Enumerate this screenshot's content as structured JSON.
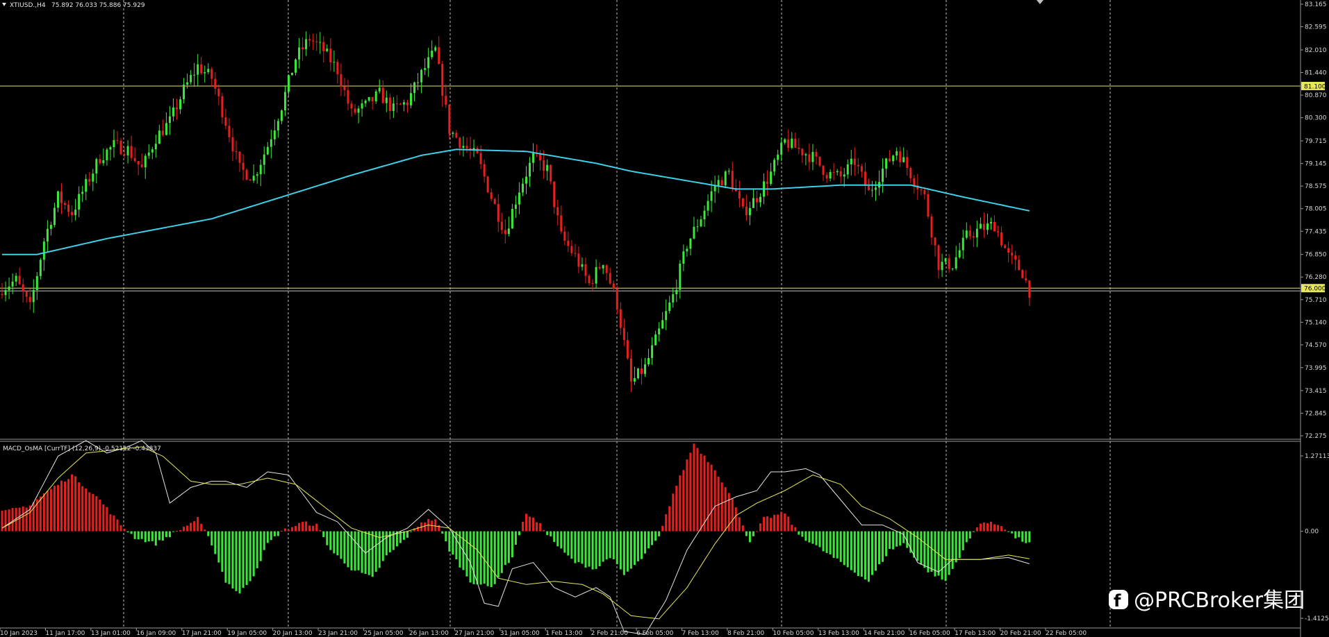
{
  "header": {
    "symbol_label": "XTIUSD.,H4",
    "ohlc": "75.892 76.033 75.886 75.929",
    "arrow_icon": "triangle-down-icon"
  },
  "indicator": {
    "label": "MACD_OsMA [CurrTF] (12,26,9) -0.52112 -0.43837"
  },
  "price_axis": {
    "labels": [
      "83.165",
      "82.595",
      "82.010",
      "81.440",
      "80.870",
      "80.300",
      "79.715",
      "79.145",
      "78.575",
      "78.005",
      "77.435",
      "76.850",
      "76.280",
      "75.710",
      "75.140",
      "74.570",
      "73.995",
      "73.415",
      "72.845",
      "72.275"
    ],
    "top": 83.165,
    "bottom": 72.275
  },
  "osma_axis": {
    "labels": [
      "1.27113",
      "0.00",
      "-1.41254"
    ],
    "top": 1.27113,
    "bottom": -1.41254
  },
  "levels": [
    {
      "value": 81.1,
      "label": "81.100",
      "color": "#e8e85a"
    },
    {
      "value": 76.0,
      "label": "76.000",
      "color": "#e8e85a"
    }
  ],
  "time_axis": [
    "10 Jan 2023",
    "11 Jan 17:00",
    "13 Jan 01:00",
    "16 Jan 09:00",
    "17 Jan 21:00",
    "19 Jan 05:00",
    "20 Jan 13:00",
    "23 Jan 21:00",
    "25 Jan 05:00",
    "26 Jan 13:00",
    "27 Jan 21:00",
    "31 Jan 05:00",
    "1 Feb 13:00",
    "2 Feb 21:00",
    "6 Feb 05:00",
    "7 Feb 13:00",
    "8 Feb 21:00",
    "10 Feb 05:00",
    "13 Feb 13:00",
    "14 Feb 21:00",
    "16 Feb 05:00",
    "17 Feb 13:00",
    "20 Feb 21:00",
    "22 Feb 05:00"
  ],
  "colors": {
    "bull": "#3be83b",
    "bear": "#e81f1f",
    "ma": "#3fd0ea",
    "macd_line": "#e6e6e6",
    "signal_line": "#e8e85a",
    "grid": "#bfbfbf",
    "background": "#000000"
  },
  "watermark": {
    "text": "@PRCBroker集团",
    "icon": "facebook-icon"
  },
  "chart_data": {
    "type": "candlestick",
    "close_anchors": [
      [
        0,
        76.0
      ],
      [
        4,
        76.2
      ],
      [
        8,
        75.5
      ],
      [
        12,
        77.2
      ],
      [
        16,
        78.3
      ],
      [
        20,
        77.9
      ],
      [
        24,
        78.6
      ],
      [
        28,
        79.3
      ],
      [
        32,
        79.6
      ],
      [
        36,
        79.5
      ],
      [
        40,
        79.0
      ],
      [
        44,
        79.8
      ],
      [
        48,
        80.2
      ],
      [
        52,
        81.0
      ],
      [
        56,
        81.6
      ],
      [
        60,
        81.3
      ],
      [
        64,
        80.2
      ],
      [
        68,
        79.0
      ],
      [
        72,
        78.8
      ],
      [
        76,
        79.6
      ],
      [
        80,
        80.6
      ],
      [
        84,
        81.8
      ],
      [
        88,
        82.3
      ],
      [
        92,
        82.0
      ],
      [
        96,
        81.5
      ],
      [
        100,
        80.4
      ],
      [
        104,
        80.6
      ],
      [
        108,
        80.9
      ],
      [
        112,
        80.5
      ],
      [
        116,
        80.7
      ],
      [
        120,
        81.4
      ],
      [
        124,
        82.0
      ],
      [
        128,
        80.0
      ],
      [
        132,
        79.6
      ],
      [
        136,
        79.3
      ],
      [
        140,
        78.3
      ],
      [
        144,
        77.4
      ],
      [
        148,
        78.5
      ],
      [
        152,
        79.3
      ],
      [
        156,
        79.0
      ],
      [
        160,
        77.3
      ],
      [
        164,
        76.8
      ],
      [
        168,
        76.1
      ],
      [
        172,
        76.7
      ],
      [
        176,
        75.6
      ],
      [
        180,
        73.6
      ],
      [
        184,
        74.0
      ],
      [
        188,
        74.9
      ],
      [
        192,
        75.8
      ],
      [
        196,
        77.1
      ],
      [
        200,
        77.8
      ],
      [
        204,
        78.6
      ],
      [
        208,
        78.9
      ],
      [
        212,
        77.9
      ],
      [
        216,
        78.3
      ],
      [
        220,
        78.9
      ],
      [
        224,
        79.7
      ],
      [
        228,
        79.5
      ],
      [
        232,
        79.3
      ],
      [
        236,
        78.9
      ],
      [
        240,
        78.8
      ],
      [
        244,
        79.2
      ],
      [
        248,
        78.4
      ],
      [
        252,
        79.0
      ],
      [
        256,
        79.5
      ],
      [
        260,
        78.9
      ],
      [
        264,
        78.3
      ],
      [
        268,
        76.6
      ],
      [
        272,
        76.6
      ],
      [
        276,
        77.3
      ],
      [
        280,
        77.5
      ],
      [
        284,
        77.6
      ],
      [
        288,
        76.8
      ],
      [
        292,
        76.4
      ],
      [
        294,
        75.93
      ]
    ],
    "ma_anchors": [
      [
        0,
        76.85
      ],
      [
        10,
        76.85
      ],
      [
        30,
        77.25
      ],
      [
        60,
        77.75
      ],
      [
        80,
        78.3
      ],
      [
        100,
        78.85
      ],
      [
        120,
        79.35
      ],
      [
        130,
        79.5
      ],
      [
        150,
        79.45
      ],
      [
        170,
        79.15
      ],
      [
        180,
        78.95
      ],
      [
        190,
        78.8
      ],
      [
        210,
        78.5
      ],
      [
        220,
        78.5
      ],
      [
        240,
        78.6
      ],
      [
        260,
        78.6
      ],
      [
        275,
        78.3
      ],
      [
        294,
        77.95
      ]
    ],
    "osma_anchors": [
      [
        0,
        0.3
      ],
      [
        8,
        0.42
      ],
      [
        12,
        0.6
      ],
      [
        20,
        0.9
      ],
      [
        28,
        0.5
      ],
      [
        34,
        0.1
      ],
      [
        38,
        -0.1
      ],
      [
        44,
        -0.2
      ],
      [
        50,
        0.0
      ],
      [
        56,
        0.2
      ],
      [
        60,
        -0.2
      ],
      [
        64,
        -0.8
      ],
      [
        68,
        -1.0
      ],
      [
        72,
        -0.7
      ],
      [
        76,
        -0.2
      ],
      [
        80,
        0.0
      ],
      [
        86,
        0.14
      ],
      [
        90,
        0.1
      ],
      [
        94,
        -0.3
      ],
      [
        100,
        -0.6
      ],
      [
        106,
        -0.75
      ],
      [
        110,
        -0.4
      ],
      [
        114,
        -0.2
      ],
      [
        120,
        0.15
      ],
      [
        124,
        0.2
      ],
      [
        128,
        -0.3
      ],
      [
        134,
        -0.8
      ],
      [
        140,
        -0.9
      ],
      [
        146,
        -0.4
      ],
      [
        150,
        0.3
      ],
      [
        154,
        0.1
      ],
      [
        160,
        -0.3
      ],
      [
        164,
        -0.5
      ],
      [
        170,
        -0.6
      ],
      [
        174,
        -0.4
      ],
      [
        178,
        -0.7
      ],
      [
        182,
        -0.5
      ],
      [
        188,
        -0.1
      ],
      [
        192,
        0.6
      ],
      [
        198,
        1.4
      ],
      [
        204,
        1.0
      ],
      [
        210,
        0.4
      ],
      [
        214,
        -0.2
      ],
      [
        218,
        0.2
      ],
      [
        224,
        0.3
      ],
      [
        228,
        -0.05
      ],
      [
        232,
        -0.2
      ],
      [
        240,
        -0.5
      ],
      [
        248,
        -0.8
      ],
      [
        254,
        -0.3
      ],
      [
        258,
        -0.2
      ],
      [
        264,
        -0.6
      ],
      [
        270,
        -0.8
      ],
      [
        276,
        -0.2
      ],
      [
        280,
        0.15
      ],
      [
        286,
        0.1
      ],
      [
        290,
        -0.1
      ],
      [
        294,
        -0.2
      ]
    ],
    "macd_anchors": [
      [
        0,
        0.05
      ],
      [
        8,
        0.35
      ],
      [
        16,
        1.2
      ],
      [
        24,
        1.45
      ],
      [
        30,
        1.25
      ],
      [
        36,
        1.35
      ],
      [
        40,
        1.45
      ],
      [
        44,
        1.25
      ],
      [
        48,
        0.45
      ],
      [
        54,
        0.7
      ],
      [
        60,
        0.8
      ],
      [
        64,
        0.8
      ],
      [
        70,
        0.7
      ],
      [
        76,
        0.95
      ],
      [
        82,
        0.9
      ],
      [
        90,
        0.3
      ],
      [
        96,
        0.15
      ],
      [
        104,
        -0.35
      ],
      [
        110,
        -0.1
      ],
      [
        116,
        0.05
      ],
      [
        122,
        0.35
      ],
      [
        128,
        0.05
      ],
      [
        134,
        -0.5
      ],
      [
        138,
        -1.15
      ],
      [
        142,
        -1.2
      ],
      [
        146,
        -0.6
      ],
      [
        152,
        -0.5
      ],
      [
        158,
        -0.9
      ],
      [
        164,
        -1.05
      ],
      [
        170,
        -0.9
      ],
      [
        174,
        -1.05
      ],
      [
        178,
        -1.6
      ],
      [
        184,
        -1.65
      ],
      [
        190,
        -1.1
      ],
      [
        196,
        -0.3
      ],
      [
        204,
        0.4
      ],
      [
        210,
        0.55
      ],
      [
        216,
        0.65
      ],
      [
        220,
        0.95
      ],
      [
        224,
        0.95
      ],
      [
        230,
        1.0
      ],
      [
        234,
        0.9
      ],
      [
        240,
        0.5
      ],
      [
        246,
        0.1
      ],
      [
        252,
        0.1
      ],
      [
        258,
        -0.05
      ],
      [
        262,
        -0.5
      ],
      [
        268,
        -0.65
      ],
      [
        272,
        -0.45
      ],
      [
        280,
        -0.45
      ],
      [
        288,
        -0.42
      ],
      [
        294,
        -0.52
      ]
    ],
    "signal_anchors": [
      [
        0,
        0.05
      ],
      [
        8,
        0.3
      ],
      [
        16,
        0.85
      ],
      [
        24,
        1.25
      ],
      [
        32,
        1.3
      ],
      [
        40,
        1.35
      ],
      [
        46,
        1.2
      ],
      [
        54,
        0.8
      ],
      [
        60,
        0.75
      ],
      [
        68,
        0.75
      ],
      [
        76,
        0.85
      ],
      [
        84,
        0.75
      ],
      [
        92,
        0.4
      ],
      [
        100,
        0.05
      ],
      [
        108,
        -0.1
      ],
      [
        116,
        0.0
      ],
      [
        122,
        0.1
      ],
      [
        128,
        0.05
      ],
      [
        136,
        -0.3
      ],
      [
        142,
        -0.75
      ],
      [
        150,
        -0.85
      ],
      [
        158,
        -0.8
      ],
      [
        166,
        -0.85
      ],
      [
        172,
        -1.0
      ],
      [
        180,
        -1.35
      ],
      [
        188,
        -1.4
      ],
      [
        196,
        -0.9
      ],
      [
        204,
        -0.2
      ],
      [
        210,
        0.25
      ],
      [
        216,
        0.45
      ],
      [
        224,
        0.65
      ],
      [
        232,
        0.9
      ],
      [
        240,
        0.75
      ],
      [
        246,
        0.4
      ],
      [
        254,
        0.2
      ],
      [
        262,
        -0.1
      ],
      [
        270,
        -0.45
      ],
      [
        280,
        -0.45
      ],
      [
        288,
        -0.38
      ],
      [
        294,
        -0.44
      ]
    ]
  }
}
